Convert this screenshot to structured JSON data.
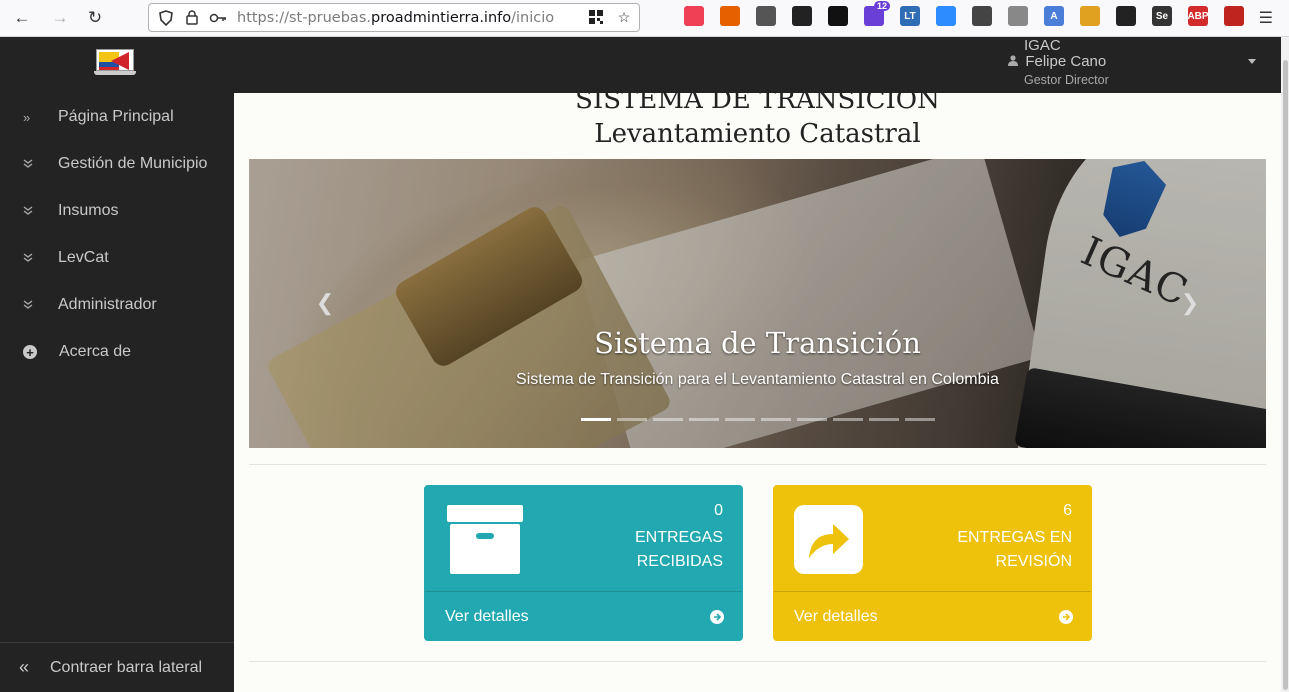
{
  "browser": {
    "url_prefix": "https://st-pruebas.",
    "url_domain": "proadmintierra.info",
    "url_path": "/inicio",
    "extension_badge": "12",
    "extensions": [
      {
        "name": "pocket-icon",
        "color": "#ef4056",
        "label": ""
      },
      {
        "name": "download-icon",
        "color": "#e66000",
        "label": ""
      },
      {
        "name": "ext-icon-a",
        "color": "#555555",
        "label": ""
      },
      {
        "name": "ext-icon-b",
        "color": "#222222",
        "label": ""
      },
      {
        "name": "ext-icon-c",
        "color": "#111111",
        "label": ""
      },
      {
        "name": "ext-icon-d",
        "color": "#6a3fd8",
        "label": ""
      },
      {
        "name": "ext-icon-e",
        "color": "#2f6db5",
        "label": "LT"
      },
      {
        "name": "zoom-icon",
        "color": "#2d8cff",
        "label": ""
      },
      {
        "name": "ext-icon-f",
        "color": "#444444",
        "label": ""
      },
      {
        "name": "ext-icon-g",
        "color": "#888888",
        "label": ""
      },
      {
        "name": "translate-icon",
        "color": "#4a7ed8",
        "label": "A"
      },
      {
        "name": "ext-icon-h",
        "color": "#e0a020",
        "label": ""
      },
      {
        "name": "ext-icon-i",
        "color": "#222222",
        "label": ""
      },
      {
        "name": "selenium-icon",
        "color": "#333333",
        "label": "Se"
      },
      {
        "name": "adblock-icon",
        "color": "#d22b2b",
        "label": "ABP"
      },
      {
        "name": "ext-icon-j",
        "color": "#c0241e",
        "label": ""
      }
    ]
  },
  "header": {
    "org": "IGAC",
    "user_name": "Felipe Cano",
    "user_role": "Gestor Director"
  },
  "sidebar": {
    "items": [
      {
        "label": "Página Principal",
        "icon": "double-chevron-right-icon"
      },
      {
        "label": "Gestión de Municipio",
        "icon": "double-chevron-down-icon"
      },
      {
        "label": "Insumos",
        "icon": "double-chevron-down-icon"
      },
      {
        "label": "LevCat",
        "icon": "double-chevron-down-icon"
      },
      {
        "label": "Administrador",
        "icon": "double-chevron-down-icon"
      },
      {
        "label": "Acerca de",
        "icon": "plus-circle-icon"
      }
    ],
    "collapse_label": "Contraer barra lateral"
  },
  "main": {
    "title_line1": "SISTEMA DE TRANSICIÓN",
    "title_line2": "Levantamiento Catastral",
    "carousel": {
      "caption_title": "Sistema de Transición",
      "caption_text": "Sistema de Transición para el Levantamiento Catastral en Colombia",
      "slide_count": 10,
      "active_index": 0
    },
    "panels": [
      {
        "count": "0",
        "label_1": "ENTREGAS",
        "label_2": "RECIBIDAS",
        "link": "Ver detalles",
        "color": "#21a8b0",
        "icon": "archive-box-icon"
      },
      {
        "count": "6",
        "label_1": "ENTREGAS EN",
        "label_2": "REVISIÓN",
        "link": "Ver detalles",
        "color": "#eec10b",
        "icon": "share-arrow-icon"
      }
    ]
  }
}
